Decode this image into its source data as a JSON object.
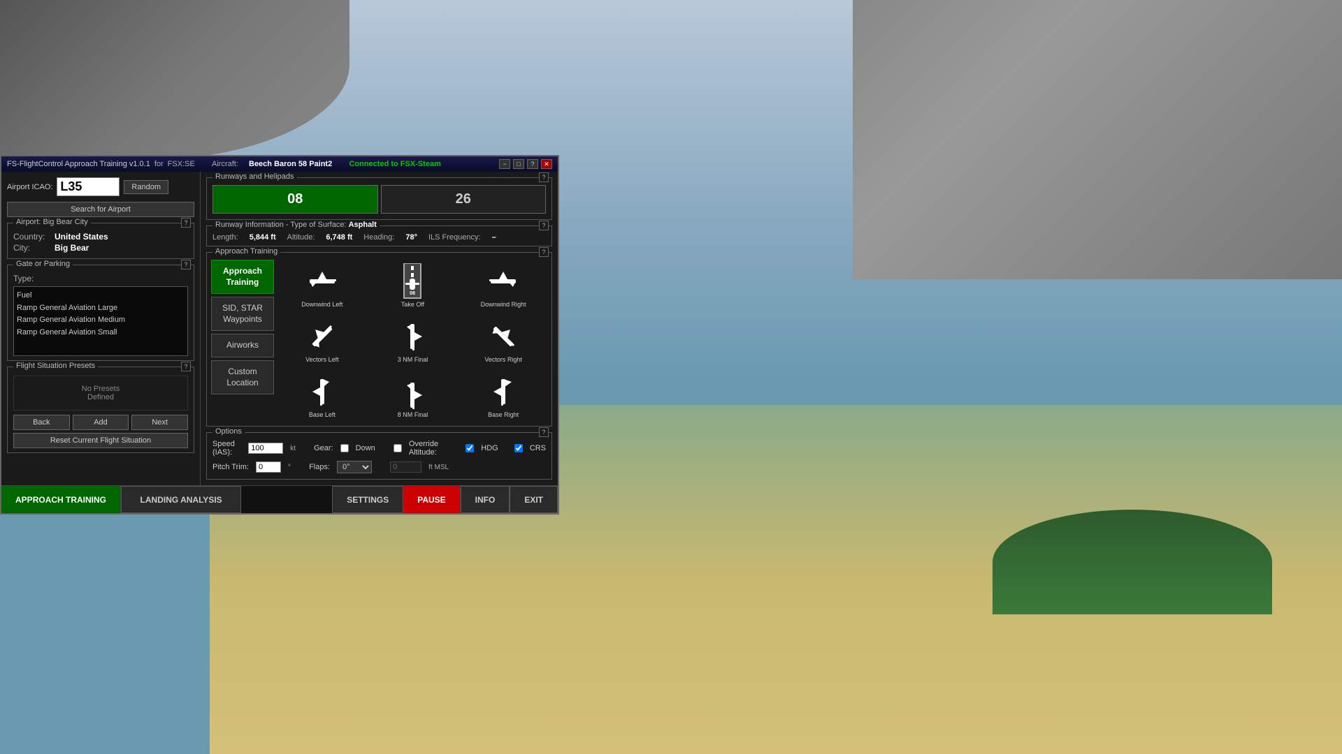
{
  "titleBar": {
    "appTitle": "FS-FlightControl Approach Training v1.0.1",
    "forLabel": "for",
    "simName": "FSX:SE",
    "aircraftLabel": "Aircraft:",
    "aircraftName": "Beech Baron 58 Paint2",
    "connectedLabel": "Connected to FSX-Steam",
    "minBtn": "−",
    "maxBtn": "□",
    "helpBtn": "?",
    "closeBtn": "✕"
  },
  "icaoRow": {
    "label": "Airport ICAO:",
    "value": "L35",
    "randomBtn": "Random"
  },
  "searchBtn": "Search for Airport",
  "airportSection": {
    "label": "Airport: Big Bear City",
    "countryKey": "Country:",
    "countryValue": "United States",
    "cityKey": "City:",
    "cityValue": "Big Bear"
  },
  "gateSection": {
    "label": "Gate or Parking",
    "typeLabel": "Type:",
    "typeItems": [
      "Fuel",
      "Ramp General Aviation Large",
      "Ramp General Aviation Medium",
      "Ramp General Aviation Small"
    ]
  },
  "presetsSection": {
    "label": "Flight Situation Presets",
    "noPresetsLine1": "No Presets",
    "noPresetsLine2": "Defined",
    "backBtn": "Back",
    "addBtn": "Add",
    "nextBtn": "Next",
    "resetBtn": "Reset Current Flight Situation"
  },
  "runwaysSection": {
    "label": "Runways and Helipads",
    "runways": [
      {
        "id": "08",
        "active": true
      },
      {
        "id": "26",
        "active": false
      }
    ]
  },
  "runwayInfo": {
    "label": "Runway Information - Type of Surface:",
    "surfaceType": "Asphalt",
    "lengthKey": "Length:",
    "lengthValue": "5,844 ft",
    "altitudeKey": "Altitude:",
    "altitudeValue": "6,748 ft",
    "headingKey": "Heading:",
    "headingValue": "78°",
    "ilsKey": "ILS Frequency:",
    "ilsValue": "–"
  },
  "approachSection": {
    "label": "Approach Training",
    "modeButtons": [
      {
        "id": "approach-training",
        "label": "Approach\nTraining",
        "active": true
      },
      {
        "id": "sid-star",
        "label": "SID, STAR\nWaypoints",
        "active": false
      },
      {
        "id": "airworks",
        "label": "Airworks",
        "active": false
      },
      {
        "id": "custom-location",
        "label": "Custom\nLocation",
        "active": false
      }
    ],
    "gridItems": [
      {
        "id": "downwind-left",
        "label": "Downwind Left",
        "type": "plane-left"
      },
      {
        "id": "take-off",
        "label": "Take Off",
        "type": "runway"
      },
      {
        "id": "downwind-right",
        "label": "Downwind Right",
        "type": "plane-right"
      },
      {
        "id": "vectors-left",
        "label": "Vectors Left",
        "type": "plane-vectors-left"
      },
      {
        "id": "3nm-final",
        "label": "3 NM Final",
        "type": "plane-3nm"
      },
      {
        "id": "vectors-right",
        "label": "Vectors Right",
        "type": "plane-vectors-right"
      },
      {
        "id": "base-left",
        "label": "Base Left",
        "type": "plane-base-left"
      },
      {
        "id": "8nm-final",
        "label": "8 NM Final",
        "type": "plane-8nm"
      },
      {
        "id": "base-right",
        "label": "Base Right",
        "type": "plane-base-right"
      }
    ]
  },
  "optionsSection": {
    "label": "Options",
    "speedKey": "Speed (IAS):",
    "speedValue": "100",
    "speedUnit": "kt",
    "gearKey": "Gear:",
    "gearDownLabel": "Down",
    "gearDownChecked": false,
    "overrideAltKey": "Override Altitude:",
    "hdgLabel": "HDG",
    "hdgChecked": true,
    "crsLabel": "CRS",
    "crsChecked": true,
    "pitchKey": "Pitch Trim:",
    "pitchValue": "0",
    "pitchUnit": "°",
    "flapsKey": "Flaps:",
    "flapsValue": "0°",
    "altValue": "0",
    "altUnit": "ft MSL"
  },
  "bottomBar": {
    "approachTrainingBtn": "APPROACH TRAINING",
    "landingAnalysisBtn": "LANDING ANALYSIS",
    "settingsBtn": "SETTINGS",
    "pauseBtn": "PAUSE",
    "infoBtn": "INFO",
    "exitBtn": "EXIT"
  }
}
